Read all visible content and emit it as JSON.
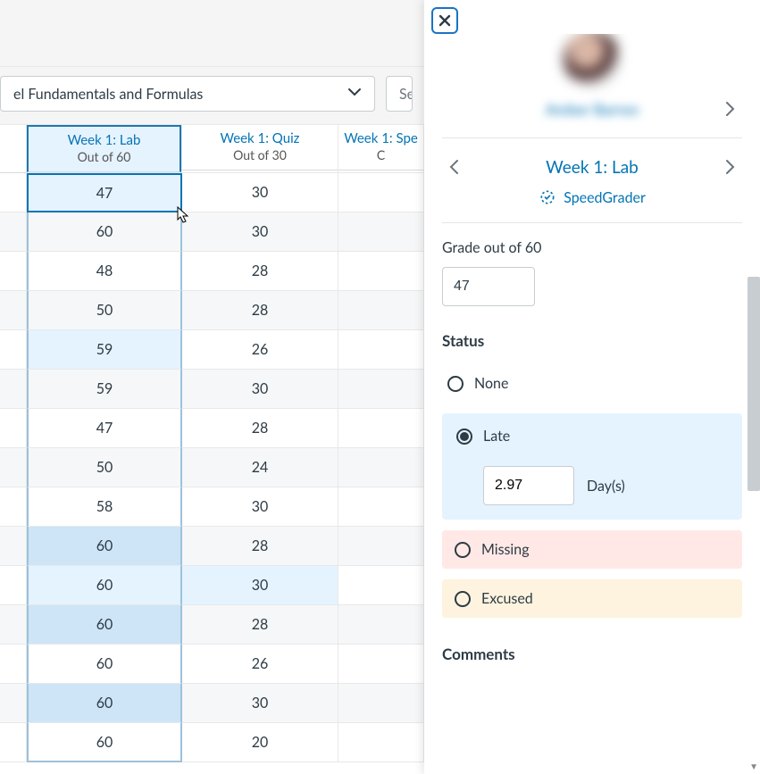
{
  "filters": {
    "module_label": "el Fundamentals and Formulas",
    "search_placeholder": "Se"
  },
  "columns": [
    {
      "title": "Week 1: Lab",
      "sub": "Out of 60"
    },
    {
      "title": "Week 1: Quiz",
      "sub": "Out of 30"
    },
    {
      "title": "Week 1: Spe",
      "sub": "C"
    }
  ],
  "rows": [
    {
      "lab": "47",
      "quiz": "30",
      "lab_shade": 1,
      "quiz_shade": 0,
      "selected": true
    },
    {
      "lab": "60",
      "quiz": "30",
      "lab_shade": 0,
      "quiz_shade": 0
    },
    {
      "lab": "48",
      "quiz": "28",
      "lab_shade": 0,
      "quiz_shade": 0
    },
    {
      "lab": "50",
      "quiz": "28",
      "lab_shade": 0,
      "quiz_shade": 0
    },
    {
      "lab": "59",
      "quiz": "26",
      "lab_shade": 1,
      "quiz_shade": 0
    },
    {
      "lab": "59",
      "quiz": "30",
      "lab_shade": 0,
      "quiz_shade": 0
    },
    {
      "lab": "47",
      "quiz": "28",
      "lab_shade": 0,
      "quiz_shade": 0
    },
    {
      "lab": "50",
      "quiz": "24",
      "lab_shade": 0,
      "quiz_shade": 0
    },
    {
      "lab": "58",
      "quiz": "30",
      "lab_shade": 0,
      "quiz_shade": 0
    },
    {
      "lab": "60",
      "quiz": "28",
      "lab_shade": 2,
      "quiz_shade": 0
    },
    {
      "lab": "60",
      "quiz": "30",
      "lab_shade": 1,
      "quiz_shade": 1
    },
    {
      "lab": "60",
      "quiz": "28",
      "lab_shade": 2,
      "quiz_shade": 0
    },
    {
      "lab": "60",
      "quiz": "26",
      "lab_shade": 0,
      "quiz_shade": 0
    },
    {
      "lab": "60",
      "quiz": "30",
      "lab_shade": 2,
      "quiz_shade": 0
    },
    {
      "lab": "60",
      "quiz": "20",
      "lab_shade": 0,
      "quiz_shade": 0
    }
  ],
  "tray": {
    "student_name": "Amber Barron",
    "assignment_name": "Week 1: Lab",
    "speedgrader_label": "SpeedGrader",
    "grade_label": "Grade out of 60",
    "grade_value": "47",
    "status_heading": "Status",
    "status_none": "None",
    "status_late": "Late",
    "late_value": "2.97",
    "late_unit": "Day(s)",
    "status_missing": "Missing",
    "status_excused": "Excused",
    "comments_heading": "Comments"
  },
  "icons": {
    "close": "close-icon",
    "chev_left": "chevron-left-icon",
    "chev_right": "chevron-right-icon",
    "chev_down": "chevron-down-icon",
    "speedgrader": "speedgrader-icon",
    "cursor": "cursor-icon"
  }
}
